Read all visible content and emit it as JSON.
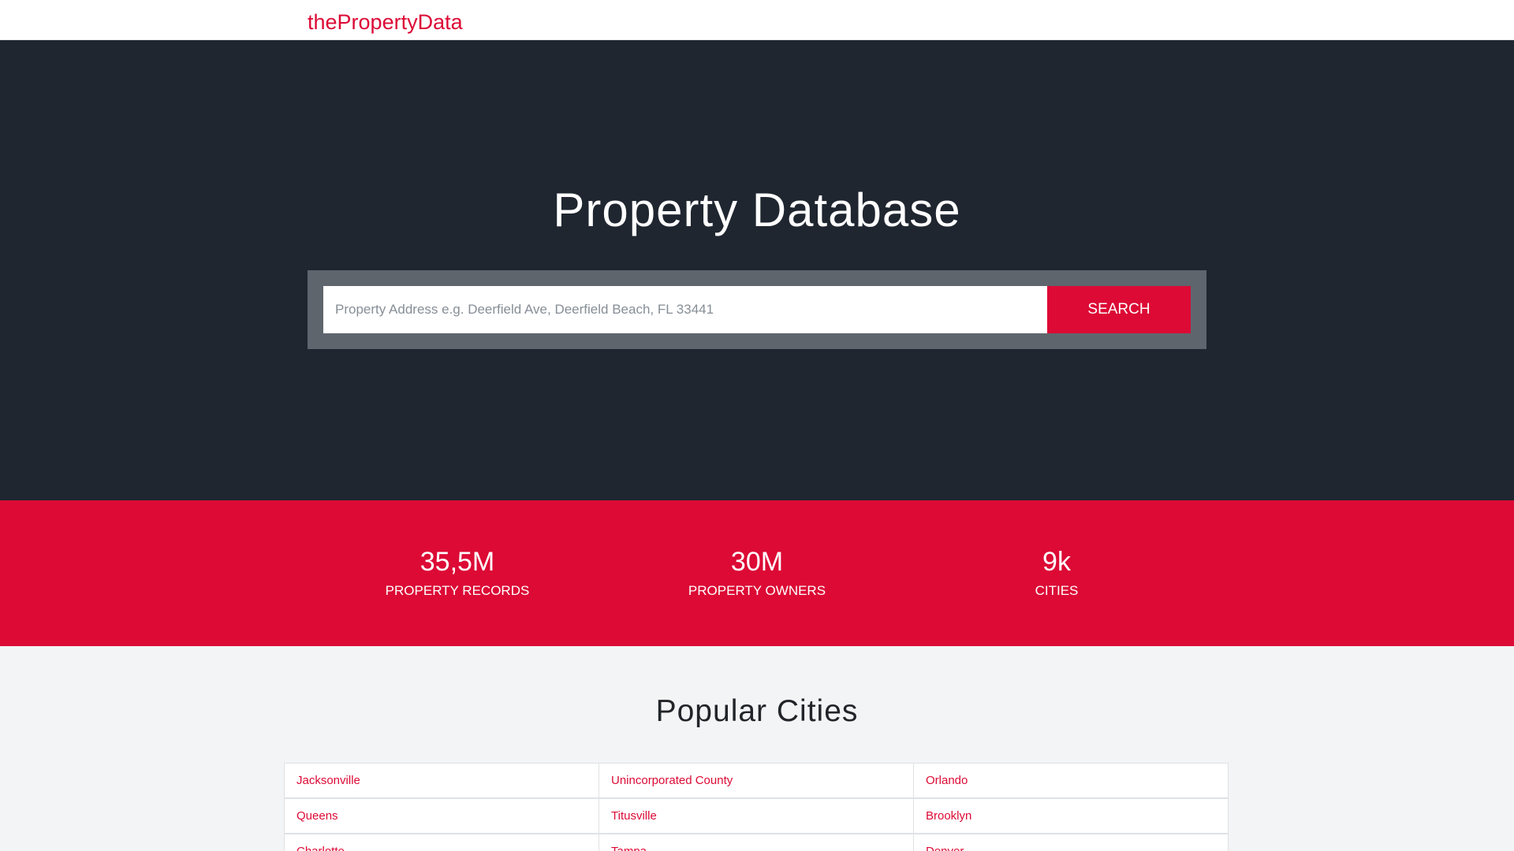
{
  "navbar": {
    "brand": "thePropertyData"
  },
  "hero": {
    "title": "Property Database",
    "search": {
      "placeholder": "Property Address e.g. Deerfield Ave, Deerfield Beach, FL 33441",
      "button_label": "SEARCH"
    }
  },
  "stats": [
    {
      "value": "35,5M",
      "label": "PROPERTY RECORDS"
    },
    {
      "value": "30M",
      "label": "PROPERTY OWNERS"
    },
    {
      "value": "9k",
      "label": "CITIES"
    }
  ],
  "popular": {
    "title": "Popular Cities",
    "rows": [
      [
        "Jacksonville",
        "Unincorporated County",
        "Orlando"
      ],
      [
        "Queens",
        "Titusville",
        "Brooklyn"
      ],
      [
        "Charlotte",
        "Tampa",
        "Denver"
      ]
    ]
  },
  "colors": {
    "accent": "#dc0a35",
    "hero_bg": "#1f2630",
    "search_frame": "#5f656d",
    "page_bg": "#f3f4f6"
  }
}
